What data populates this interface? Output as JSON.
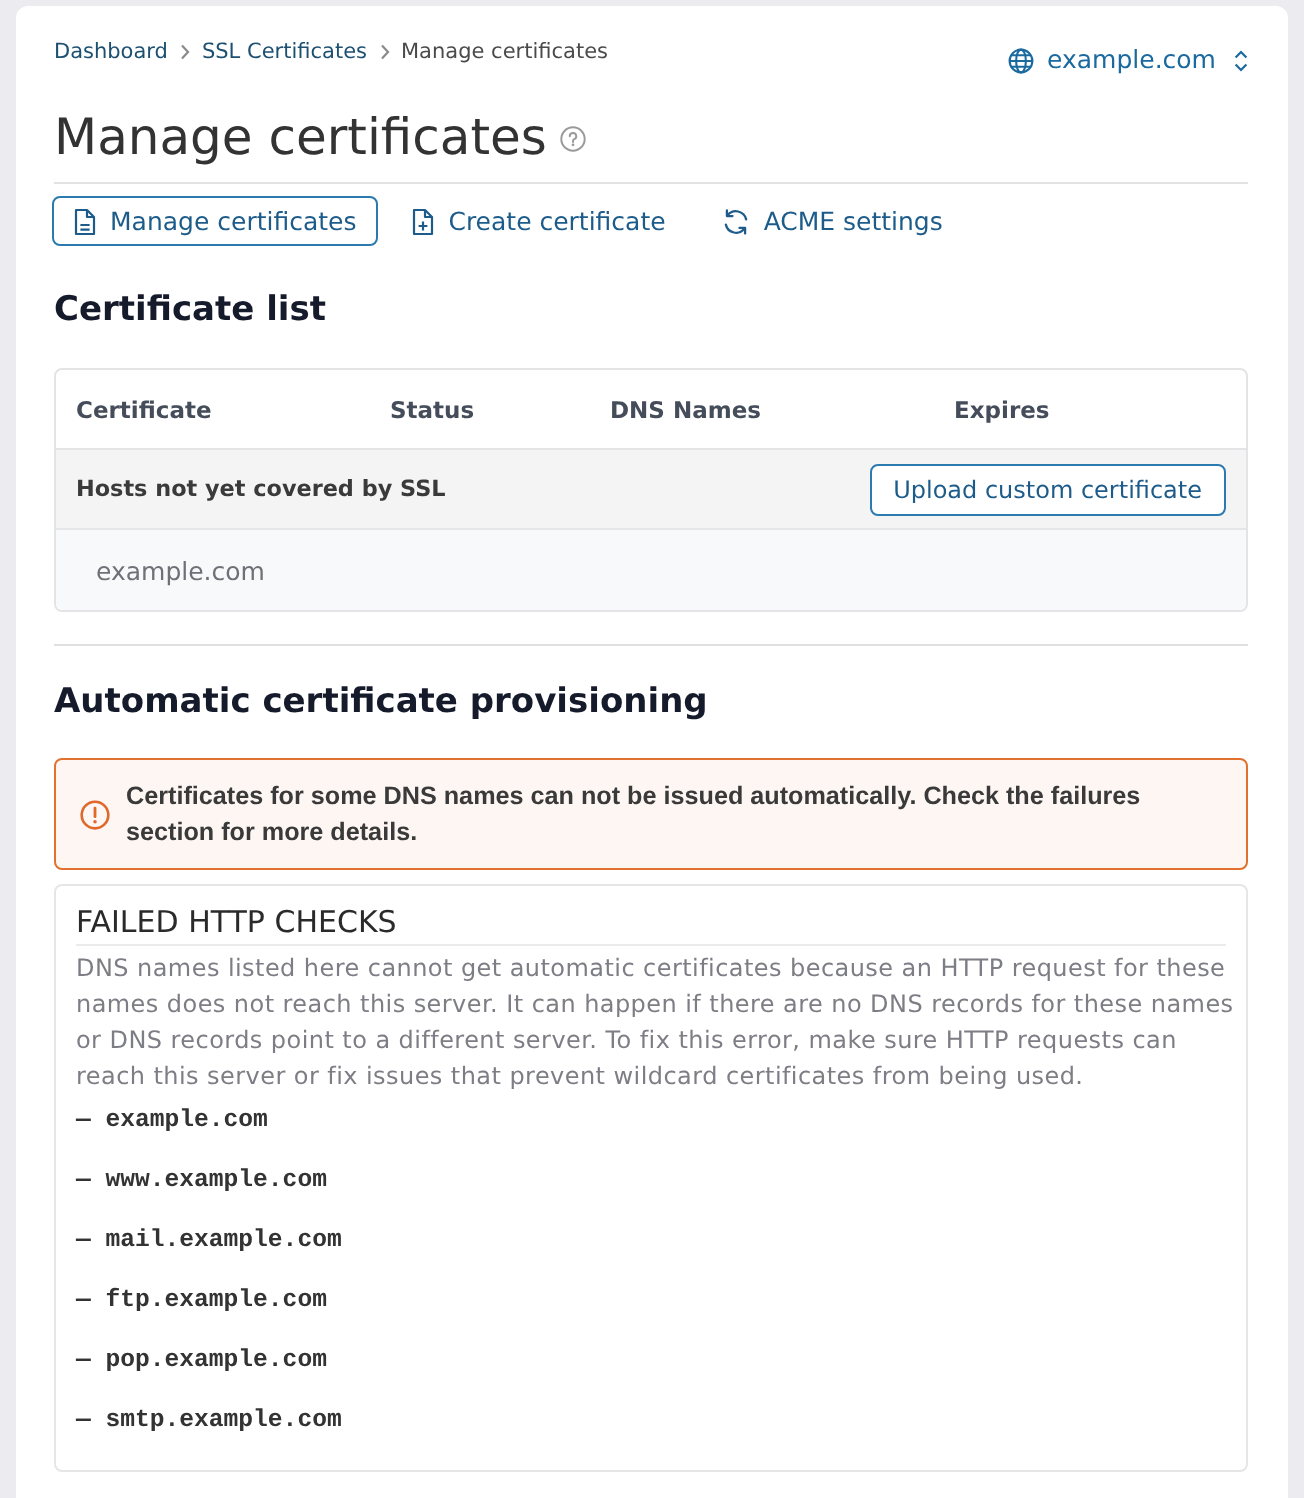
{
  "breadcrumb": [
    {
      "label": "Dashboard",
      "kind": "link"
    },
    {
      "label": "SSL Certificates",
      "kind": "link"
    },
    {
      "label": "Manage certificates",
      "kind": "current"
    }
  ],
  "domain_selector": {
    "value": "example.com"
  },
  "page_title": "Manage certificates",
  "tabs": [
    {
      "label": "Manage certificates",
      "kind": "list",
      "selected": true
    },
    {
      "label": "Create certificate",
      "kind": "create",
      "selected": false
    },
    {
      "label": "ACME settings",
      "kind": "settings",
      "selected": false
    }
  ],
  "certificate_list": {
    "title": "Certificate list",
    "columns": [
      "Certificate",
      "Status",
      "DNS Names",
      "Expires"
    ],
    "group": {
      "label": "Hosts not yet covered by SSL",
      "button": "Upload custom certificate"
    },
    "hosts": [
      "example.com"
    ]
  },
  "provisioning": {
    "title": "Automatic certificate provisioning",
    "alert": "Certificates for some DNS names can not be issued automatically. Check the failures section for more details.",
    "failed_checks": {
      "title": "FAILED HTTP CHECKS",
      "description": "DNS names listed here cannot get automatic certificates because an HTTP request for these names does not reach this server. It can happen if there are no DNS records for these names or DNS records point to a different server. To fix this error, make sure HTTP requests can reach this server or fix issues that prevent wildcard certificates from being used.",
      "names": [
        "— example.com",
        "— www.example.com",
        "— mail.example.com",
        "— ftp.example.com",
        "— pop.example.com",
        "— smtp.example.com"
      ]
    }
  }
}
